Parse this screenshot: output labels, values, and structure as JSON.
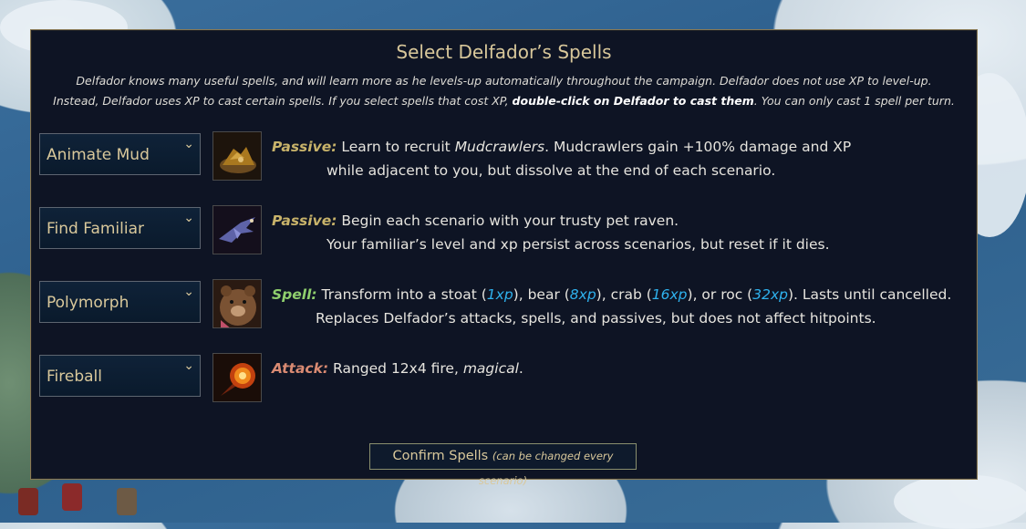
{
  "dialog": {
    "title": "Select Delfador’s Spells",
    "intro_line1": "Delfador knows many useful spells, and will learn more as he levels-up automatically throughout the campaign. Delfador does not use XP to level-up.",
    "intro_line2a": "Instead, Delfador uses XP to cast certain spells. If you select spells that cost XP, ",
    "intro_line2b": "double-click on Delfador to cast them",
    "intro_line2c": ". You can only cast 1 spell per turn."
  },
  "colors": {
    "passive": "#c8b36a",
    "spell": "#8fcf6d",
    "attack": "#d98a72",
    "xp": "#2fb2ee"
  },
  "spells": [
    {
      "select": "Animate Mud",
      "icon": "mud-pile-icon",
      "tag": "Passive:",
      "text_a": " Learn to recruit ",
      "text_em": "Mudcrawlers",
      "text_b": ". Mudcrawlers gain +100% damage and XP",
      "line2": "while adjacent to you, but dissolve at the end of each scenario."
    },
    {
      "select": "Find Familiar",
      "icon": "raven-icon",
      "tag": "Passive:",
      "text": " Begin each scenario with your trusty pet raven.",
      "line2": "Your familiar’s level and xp persist across scenarios, but reset if it dies."
    },
    {
      "select": "Polymorph",
      "icon": "bear-icon",
      "tag": "Spell:",
      "parts": [
        " Transform into a stoat (",
        "1xp",
        "), bear (",
        "8xp",
        "), crab (",
        "16xp",
        "), or roc (",
        "32xp",
        "). Lasts until cancelled."
      ],
      "line2": "Replaces Delfador’s attacks, spells, and passives, but does not affect hitpoints."
    },
    {
      "select": "Fireball",
      "icon": "fireball-icon",
      "tag": "Attack:",
      "text_a": " Ranged 12x4 fire, ",
      "text_em": "magical",
      "text_b": "."
    }
  ],
  "confirm": {
    "label": "Confirm Spells",
    "note": "(can be changed every scenario)"
  }
}
